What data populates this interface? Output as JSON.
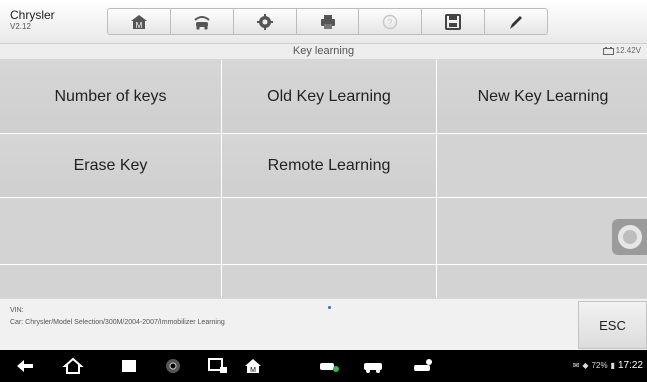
{
  "app": {
    "name": "Chrysler",
    "version": "V2.12"
  },
  "toolbar": {
    "buttons": [
      {
        "icon": "home-icon"
      },
      {
        "icon": "vehicle-swap-icon"
      },
      {
        "icon": "settings-icon"
      },
      {
        "icon": "print-icon"
      },
      {
        "icon": "help-icon",
        "disabled": true
      },
      {
        "icon": "save-icon"
      },
      {
        "icon": "pen-icon"
      }
    ]
  },
  "header": {
    "title": "Key learning",
    "voltage": "12.42V"
  },
  "menu": {
    "items": [
      "Number of keys",
      "Old Key Learning",
      "New Key Learning",
      "Erase Key",
      "Remote Learning"
    ]
  },
  "footer": {
    "vin": "VIN:",
    "path": "Car: Chrysler/Model Selection/300M/2004-2007/Immobilizer Learning",
    "esc": "ESC"
  },
  "status": {
    "battery": "72%",
    "time": "17:22"
  },
  "colors": {
    "accent": "#2b6ed6",
    "cell": "#d3d3d3"
  }
}
